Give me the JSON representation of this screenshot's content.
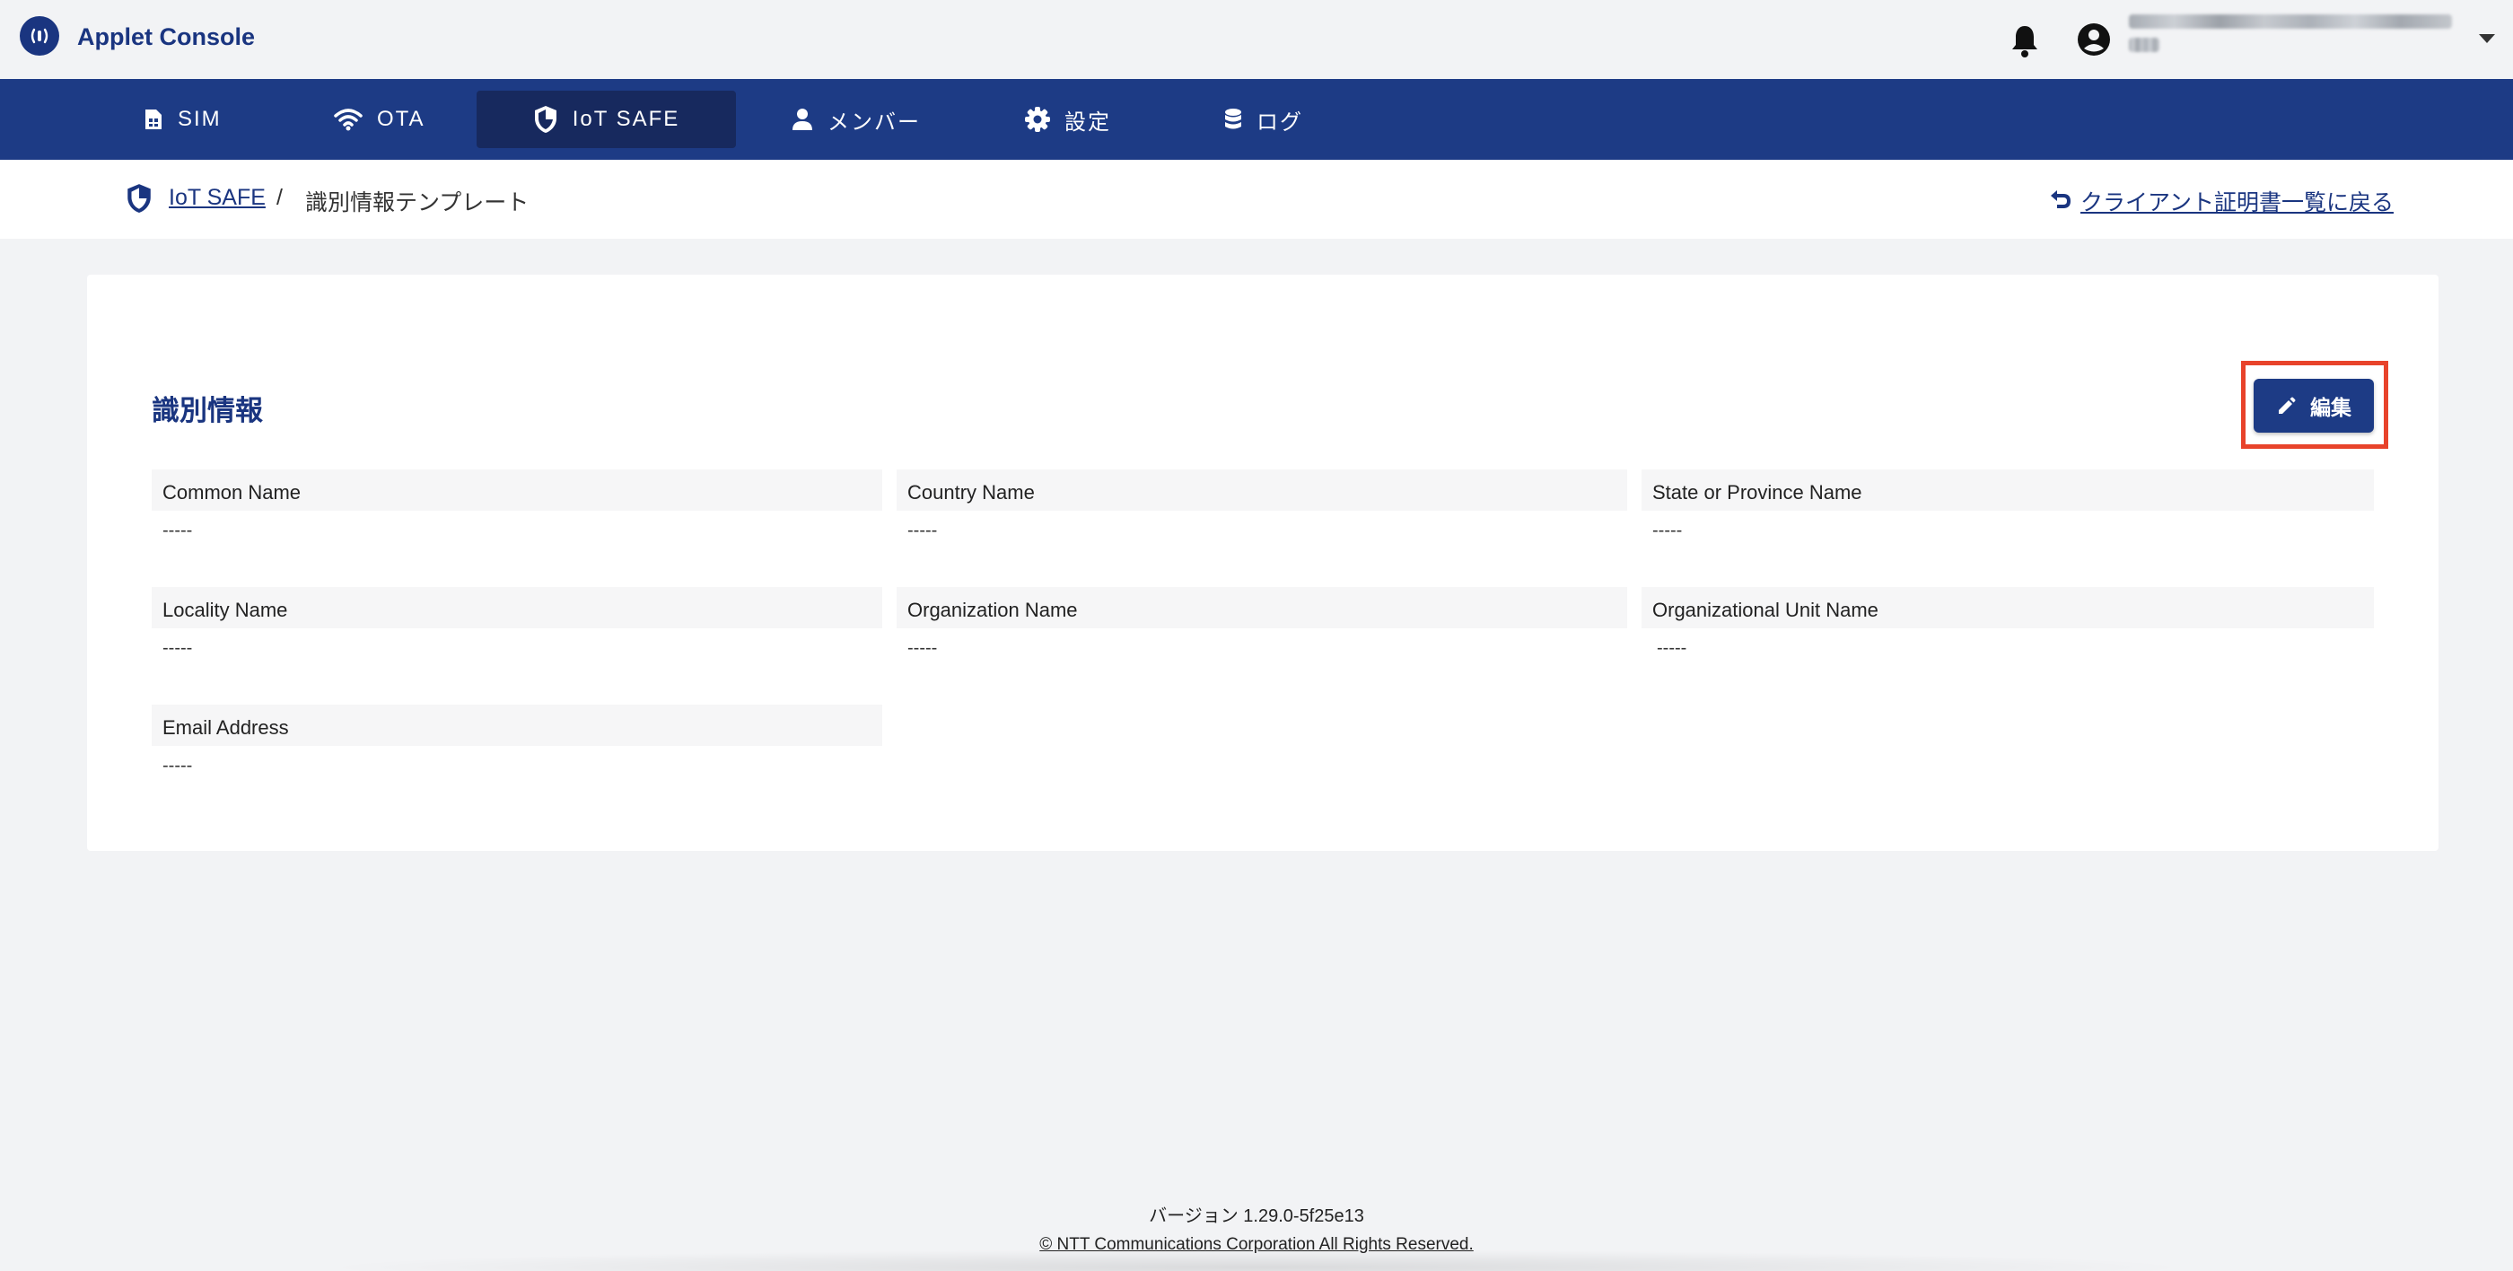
{
  "app": {
    "title": "Applet Console",
    "logo_icon": "signal-icon"
  },
  "header": {
    "notification_icon": "bell-icon",
    "account_icon": "account-circle-icon",
    "account_menu_icon": "caret-down-icon"
  },
  "nav": {
    "items": [
      {
        "label": "SIM",
        "icon": "sim-card-icon",
        "active": false
      },
      {
        "label": "OTA",
        "icon": "wifi-icon",
        "active": false
      },
      {
        "label": "IoT SAFE",
        "icon": "shield-icon",
        "active": true
      },
      {
        "label": "メンバー",
        "icon": "person-icon",
        "active": false
      },
      {
        "label": "設定",
        "icon": "gear-icon",
        "active": false
      },
      {
        "label": "ログ",
        "icon": "database-icon",
        "active": false
      }
    ]
  },
  "breadcrumb": {
    "root": "IoT SAFE",
    "separator": "/",
    "current": "識別情報テンプレート",
    "back_link": "クライアント証明書一覧に戻る"
  },
  "section": {
    "title": "識別情報",
    "edit_label": "編集"
  },
  "fields": [
    {
      "label": "Common Name",
      "value": "-----"
    },
    {
      "label": "Country Name",
      "value": "-----"
    },
    {
      "label": "State or Province Name",
      "value": "-----"
    },
    {
      "label": "Locality Name",
      "value": "-----"
    },
    {
      "label": "Organization Name",
      "value": "-----"
    },
    {
      "label": "Organizational Unit Name",
      "value": "-----"
    },
    {
      "label": "Email Address",
      "value": "-----"
    }
  ],
  "footer": {
    "version": "バージョン 1.29.0-5f25e13",
    "copyright": "© NTT Communications Corporation All Rights Reserved."
  },
  "colors": {
    "brand": "#1d3b85",
    "nav_active": "#17295e",
    "highlight": "#e8432b"
  }
}
